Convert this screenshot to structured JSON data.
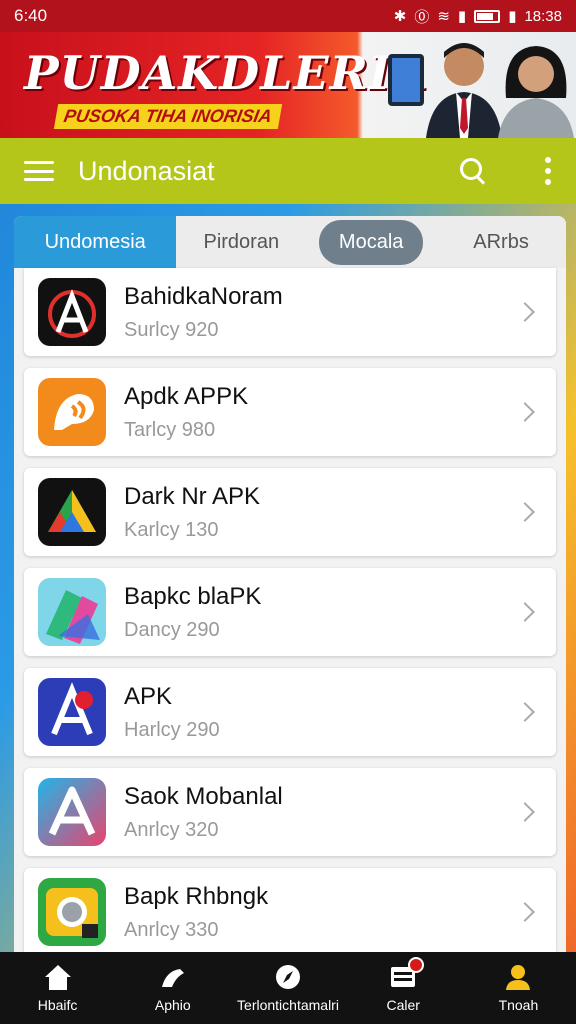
{
  "status_bar": {
    "time": "6:40",
    "clock": "18:38"
  },
  "banner": {
    "title": "PUDAKDLERIA",
    "subtitle": "PUSOKA TIHA INORISIA"
  },
  "app_bar": {
    "title": "Undonasiat"
  },
  "tabs": [
    {
      "label": "Undomesia"
    },
    {
      "label": "Pirdoran"
    },
    {
      "label": "Mocala"
    },
    {
      "label": "ARrbs"
    }
  ],
  "apps": [
    {
      "name": "BahidkaNoram",
      "meta": "Surlcy  920",
      "icon": "letter-a-dark-icon"
    },
    {
      "name": "Apdk APPK",
      "meta": "Tarlcy  980",
      "icon": "orange-signal-icon"
    },
    {
      "name": "Dark Nr APK",
      "meta": "Karlcy  130",
      "icon": "drive-triangle-icon"
    },
    {
      "name": "Bapkc blaPK",
      "meta": "Dancy  290",
      "icon": "pastel-layers-icon"
    },
    {
      "name": "APK",
      "meta": "Harlcy  290",
      "icon": "letter-a-blue-icon"
    },
    {
      "name": "Saok Mobanlal",
      "meta": "Anrlcy  320",
      "icon": "letter-a-gradient-icon"
    },
    {
      "name": "Bapk Rhbngk",
      "meta": "Anrlcy  330",
      "icon": "camera-green-icon"
    }
  ],
  "bottom_nav": [
    {
      "label": "Hbaifc",
      "icon": "home-icon"
    },
    {
      "label": "Aphio",
      "icon": "apps-icon"
    },
    {
      "label": "Terlontichtamalri",
      "icon": "compass-icon"
    },
    {
      "label": "Caler",
      "icon": "inbox-icon"
    },
    {
      "label": "Tnoah",
      "icon": "profile-icon"
    }
  ],
  "colors": {
    "status_bar": "#b1121c",
    "app_bar": "#b5c61a",
    "tab_active": "#2a9bd8",
    "tab_pill": "#6f7f8c",
    "nav_bg": "#121212"
  }
}
